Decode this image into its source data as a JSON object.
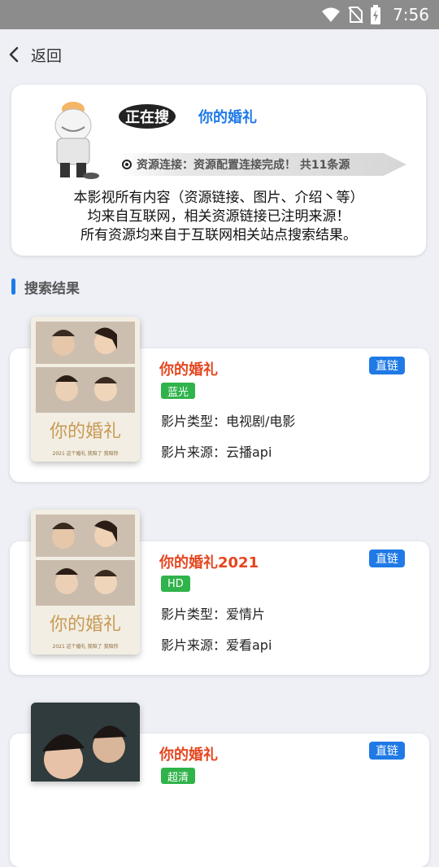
{
  "status_bar": {
    "time": "7:56",
    "icons": [
      "wifi-icon",
      "no-sim-icon",
      "battery-charging-icon"
    ]
  },
  "header": {
    "back_label": "返回",
    "back_icon": "chevron-left-icon"
  },
  "search_info": {
    "searching_label": "正在搜",
    "query": "你的婚礼",
    "connection_status": "资源连接：资源配置连接完成！  共11条源",
    "disclaimer": [
      "本影视所有内容（资源链接、图片、介绍丶等）",
      "均来自互联网，相关资源链接已注明来源！",
      "所有资源均来自于互联网相关站点搜索结果。"
    ]
  },
  "results_section": {
    "title": "搜索结果"
  },
  "results": [
    {
      "title": "你的婚礼",
      "link_type": "直链",
      "quality": "蓝光",
      "type_text": "影片类型：电视剧/电影",
      "source_text": "影片来源：云播api",
      "poster_title": "你的婚礼",
      "poster_caption": "2021  这个婚礼 我陪了 我陪你"
    },
    {
      "title": "你的婚礼2021",
      "link_type": "直链",
      "quality": "HD",
      "type_text": "影片类型：爱情片",
      "source_text": "影片来源：爱看api",
      "poster_title": "你的婚礼",
      "poster_caption": "2021  这个婚礼 我陪了 我陪你"
    },
    {
      "title": "你的婚礼",
      "link_type": "直链",
      "quality": "超清",
      "type_text": "",
      "source_text": "",
      "poster_title": "",
      "poster_caption": ""
    }
  ],
  "colors": {
    "accent_blue": "#1f7ae6",
    "title_red": "#e5461f",
    "quality_green": "#2fb34a",
    "background": "#eef0f6"
  }
}
